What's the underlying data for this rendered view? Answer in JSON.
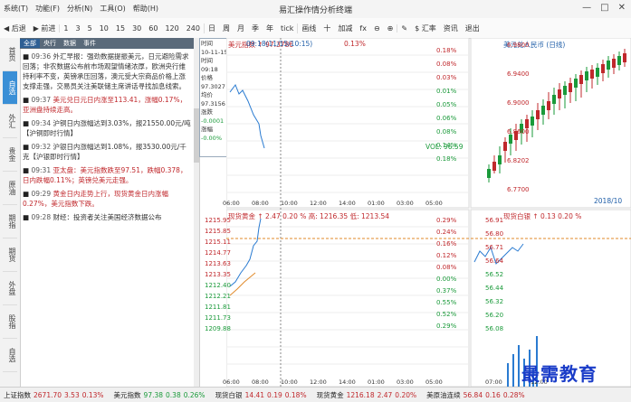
{
  "titlebar": {
    "menus": [
      "系统(T)",
      "功能(F)",
      "分析(N)",
      "工具(O)",
      "帮助(H)"
    ],
    "app_title": "易汇操作情分析终端",
    "controls": [
      "—",
      "□",
      "✕"
    ]
  },
  "toolbar": {
    "buttons": [
      "后退",
      "前进",
      "1",
      "3",
      "5",
      "10",
      "15",
      "30",
      "60",
      "120",
      "240",
      "日",
      "周",
      "月",
      "季",
      "年",
      "tick",
      "画线",
      "十",
      "加减",
      "fx",
      "缩小",
      "放大"
    ],
    "right_buttons": [
      "画线",
      "$ 汇率",
      "资讯",
      "退出"
    ]
  },
  "vtabs": [
    "首页",
    "自选",
    "外汇",
    "贵金",
    "原油",
    "期指",
    "期货",
    "外盘",
    "股指",
    "自选"
  ],
  "news": {
    "tabs": [
      "全部",
      "央行",
      "数据",
      "事件"
    ],
    "active_tab": 0,
    "items": [
      {
        "time": "09:36",
        "text": "外汇早报：强劲数据提振美元，日元避险需求回落；非农数据公布前市场观望情绪浓厚，欧洲央行维持利率不变，英镑承压回落，澳元受大宗商品价格上涨支撑走强，交易员关注美联储主席讲话寻找加息线索。",
        "color": "dark"
      },
      {
        "time": "09:37",
        "text": "美元兑日元日内涨至113.41，涨幅0.17%，亚洲盘持续走高。",
        "color": "red"
      },
      {
        "time": "09:34",
        "text": "沪铜日内涨幅达到3.03%，报21550.00元/吨【沪铜即时行情】",
        "color": "dark"
      },
      {
        "time": "09:32",
        "text": "沪银日内涨幅达到1.08%，报3530.00元/千克【沪银即时行情】",
        "color": "dark"
      },
      {
        "time": "09:31",
        "text": "亚太盘：美元指数跌至97.51，跌幅0.378，日内跌幅0.11%；英镑兑美元走强。",
        "color": "red"
      },
      {
        "time": "09:29",
        "text": "黄金日内走势上行，现货黄金日内涨幅0.27%，美元指数下跌。",
        "color": "red"
      },
      {
        "time": "09:28",
        "text": "财经：投资者关注美国经济数据公布",
        "color": "dark"
      }
    ]
  },
  "infobox": {
    "lines": [
      "时间",
      "10-11-15",
      "时间",
      "09:18",
      "价格",
      "97.3027",
      "均价",
      "97.3156",
      "涨跌",
      "-0.0001",
      "涨幅",
      "-0.00%"
    ]
  },
  "charts": {
    "usdx": {
      "title": "美元指数",
      "price": "↑ 97.3786",
      "chg": "0.13%",
      "pct_right": [
        "0.18%",
        "0.08%",
        "0.03%",
        "0.01%",
        "0.05%",
        "0.06%",
        "0.08%",
        "0.14%",
        "0.18%"
      ],
      "vol": "VOL: 96.59"
    },
    "rmb": {
      "title": "美元兑人民币",
      "rate": "(日线)",
      "ticks": [
        "6.9800",
        "6.9400",
        "6.9000",
        "6.8600",
        "6.8202",
        "6.7700"
      ],
      "x_right": "2018/10"
    },
    "gold": {
      "title": "现货黄金",
      "price": "↑ 2.47",
      "pct": "0.20 %",
      "high": "高: 1216.35",
      "low": "低: 1213.54",
      "ticks": [
        "1215.95",
        "1215.85",
        "1215.11",
        "1214.77",
        "1213.63",
        "1213.35",
        "1212.40",
        "1212.21",
        "1211.81",
        "1211.73",
        "1209.88"
      ],
      "pcts": [
        "0.29%",
        "0.24%",
        "0.16%",
        "0.12%",
        "0.08%",
        "0.00%",
        "0.37%",
        "0.55%",
        "0.52%",
        "0.29%"
      ]
    },
    "silver": {
      "title": "现货白银",
      "price": "↑ 0.13",
      "pct": "0.20 %",
      "ticks": [
        "56.91",
        "56.80",
        "56.71",
        "56.64",
        "56.52",
        "56.44",
        "56.32",
        "56.20",
        "56.08"
      ]
    },
    "time_axis_top": [
      "06:00",
      "08:00",
      "10:00",
      "12:00",
      "14:00",
      "01:00",
      "03:00",
      "05:00"
    ],
    "time_axis_bottom": [
      "06:00",
      "08:00",
      "10:00",
      "12:00",
      "14:00",
      "01:00",
      "03:00",
      "05:00"
    ],
    "time_axis_small": [
      "07:00",
      "12:00"
    ],
    "label_cursor": "09:18(11/15/10:15)"
  },
  "statusbar": {
    "items": [
      {
        "label": "上证指数",
        "val": "2671.70",
        "chg": "3.53",
        "pct": "0.13%",
        "color": "r"
      },
      {
        "label": "美元指数",
        "val": "97.38",
        "chg": "0.38",
        "pct": "0.26%",
        "color": "g"
      },
      {
        "label": "现货白银",
        "val": "14.41",
        "chg": "0.19",
        "pct": "0.18%",
        "color": "r"
      },
      {
        "label": "现货黄金",
        "val": "1216.18",
        "chg": "2.47",
        "pct": "0.20%",
        "color": "r"
      },
      {
        "label": "美原油连续",
        "val": "56.84",
        "chg": "0.16",
        "pct": "0.28%",
        "color": "r"
      }
    ]
  },
  "watermark": "最需教育"
}
